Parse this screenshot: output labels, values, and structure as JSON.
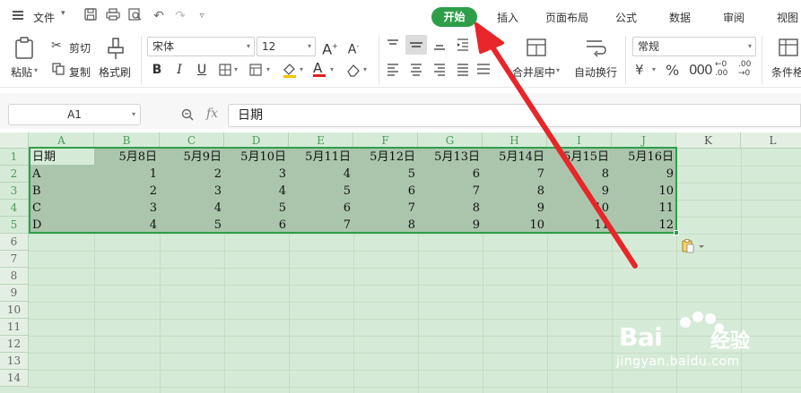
{
  "menubar": {
    "file_label": "文件",
    "tabs": [
      "开始",
      "插入",
      "页面布局",
      "公式",
      "数据",
      "审阅",
      "视图"
    ],
    "active_tab": "开始"
  },
  "ribbon": {
    "paste_label": "粘贴",
    "cut_label": "剪切",
    "copy_label": "复制",
    "format_painter_label": "格式刷",
    "font_name": "宋体",
    "font_size": "12",
    "merge_center_label": "合并居中",
    "auto_wrap_label": "自动换行",
    "number_format": "常规",
    "conditional_format_label": "条件格"
  },
  "formula_bar": {
    "name_box": "A1",
    "fx_label": "fx",
    "content": "日期"
  },
  "sheet": {
    "columns": [
      "A",
      "B",
      "C",
      "D",
      "E",
      "F",
      "G",
      "H",
      "I",
      "J",
      "K",
      "L"
    ],
    "rows": [
      "1",
      "2",
      "3",
      "4",
      "5",
      "6",
      "7",
      "8",
      "9",
      "10",
      "11",
      "12",
      "13",
      "14"
    ],
    "cells": [
      [
        "日期",
        "5月8日",
        "5月9日",
        "5月10日",
        "5月11日",
        "5月12日",
        "5月13日",
        "5月14日",
        "5月15日",
        "5月16日"
      ],
      [
        "A",
        "1",
        "2",
        "3",
        "4",
        "5",
        "6",
        "7",
        "8",
        "9"
      ],
      [
        "B",
        "2",
        "3",
        "4",
        "5",
        "6",
        "7",
        "8",
        "9",
        "10"
      ],
      [
        "C",
        "3",
        "4",
        "5",
        "6",
        "7",
        "8",
        "9",
        "10",
        "11"
      ],
      [
        "D",
        "4",
        "5",
        "6",
        "7",
        "8",
        "9",
        "10",
        "11",
        "12"
      ]
    ]
  },
  "watermark": {
    "brand": "Bai",
    "brand_cn": "经验",
    "url": "jingyan.baidu.com"
  },
  "colors": {
    "accent_green": "#2e9e4a",
    "arrow_red": "#e8262a",
    "sheet_bg": "#d6ebd7",
    "selection_bg": "#aac5ac"
  }
}
